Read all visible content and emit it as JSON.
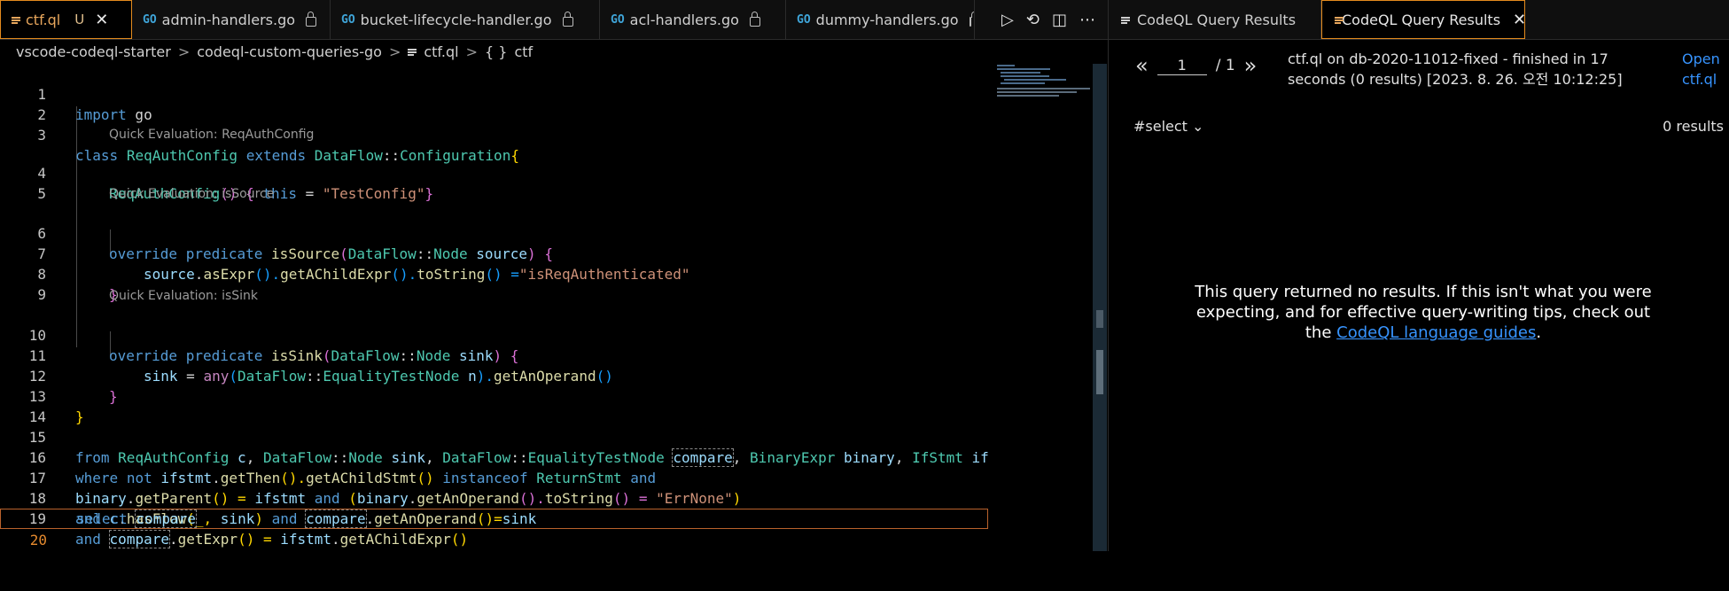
{
  "editor": {
    "tabs": [
      {
        "label": "ctf.ql",
        "status": "U"
      },
      {
        "label": "admin-handlers.go"
      },
      {
        "label": "bucket-lifecycle-handler.go"
      },
      {
        "label": "acl-handlers.go"
      },
      {
        "label": "dummy-handlers.go"
      }
    ],
    "close_glyph": "✕",
    "go_icon_text": "GO",
    "breadcrumb": [
      "vscode-codeql-starter",
      "codeql-custom-queries-go",
      "ctf.ql",
      "ctf"
    ],
    "breadcrumb_symbol_glyph": "{ }",
    "quick_eval": {
      "l4": "Quick Evaluation: ReqAuthConfig",
      "l6": "Quick Evaluation: isSource",
      "l10": "Quick Evaluation: isSink"
    },
    "line_numbers": [
      "1",
      "2",
      "3",
      "4",
      "5",
      "6",
      "7",
      "8",
      "9",
      "10",
      "11",
      "12",
      "13",
      "14",
      "15",
      "16",
      "17",
      "18",
      "19",
      "20"
    ],
    "code": {
      "l1": [
        "import",
        " go"
      ],
      "l3": [
        "class",
        " ",
        "ReqAuthConfig",
        " ",
        "extends",
        " ",
        "DataFlow",
        "::",
        "Configuration",
        "{"
      ],
      "l4": [
        "ReqAuthConfig",
        "()",
        " ",
        "{",
        " ",
        "this",
        " = ",
        "\"TestConfig\"",
        "}"
      ],
      "l6": [
        "override",
        " ",
        "predicate",
        " ",
        "isSource",
        "(",
        "DataFlow",
        "::",
        "Node",
        " ",
        "source",
        ")",
        " ",
        "{"
      ],
      "l7": [
        "source",
        ".",
        "asExpr",
        "().",
        "getAChildExpr",
        "().",
        "toString",
        "() =",
        "\"isReqAuthenticated\""
      ],
      "l8": [
        "}"
      ],
      "l10": [
        "override",
        " ",
        "predicate",
        " ",
        "isSink",
        "(",
        "DataFlow",
        "::",
        "Node",
        " ",
        "sink",
        ")",
        " ",
        "{"
      ],
      "l11": [
        "sink",
        " = ",
        "any",
        "(",
        "DataFlow",
        "::",
        "EqualityTestNode",
        " ",
        "n",
        ").",
        "getAnOperand",
        "()"
      ],
      "l12": [
        "}"
      ],
      "l13": [
        "}"
      ],
      "l15": [
        "from",
        " ",
        "ReqAuthConfig",
        " ",
        "c",
        ", ",
        "DataFlow",
        "::",
        "Node",
        " ",
        "sink",
        ", ",
        "DataFlow",
        "::",
        "EqualityTestNode",
        " ",
        "compare",
        ", ",
        "BinaryExpr",
        " ",
        "binary",
        ", ",
        "IfStmt",
        " ",
        "if"
      ],
      "l16": [
        "where",
        " ",
        "not",
        " ",
        "ifstmt",
        ".",
        "getThen",
        "().",
        "getAChildStmt",
        "() ",
        "instanceof",
        " ",
        "ReturnStmt",
        " ",
        "and"
      ],
      "l17": [
        "binary",
        ".",
        "getParent",
        "() = ",
        "ifstmt",
        " ",
        "and",
        " (",
        "binary",
        ".",
        "getAnOperand",
        "().",
        "toString",
        "() = ",
        "\"ErrNone\"",
        ")"
      ],
      "l18": [
        "and",
        " ",
        "c",
        ".",
        "hasFlow",
        "(_, ",
        "sink",
        ") ",
        "and",
        " ",
        "compare",
        ".",
        "getAnOperand",
        "()=",
        "sink"
      ],
      "l19": [
        "and",
        " ",
        "compare",
        ".",
        "getExpr",
        "() = ",
        "ifstmt",
        ".",
        "getAChildExpr",
        "()"
      ],
      "l20": [
        "select",
        " ",
        "compare"
      ]
    },
    "actions": [
      "▷",
      "⟲",
      "◫",
      "⋯"
    ]
  },
  "results": {
    "tabs": [
      {
        "label": "CodeQL Query Results"
      },
      {
        "label": "CodeQL Query Results"
      }
    ],
    "pager": {
      "prev": "«",
      "page": "1",
      "total": "/ 1",
      "next": "»"
    },
    "summary": "ctf.ql on db-2020-11012-fixed - finished in 17 seconds (0 results) [2023. 8. 26. 오전 10:12:25]",
    "open_link": "Open ctf.ql",
    "select_label": "#select",
    "select_chevron": "⌄",
    "count": "0 results",
    "no_results_text": "This query returned no results. If this isn't what you were expecting, and for effective query-writing tips, check out the",
    "no_results_link": "CodeQL language guides",
    "no_results_end": "."
  }
}
